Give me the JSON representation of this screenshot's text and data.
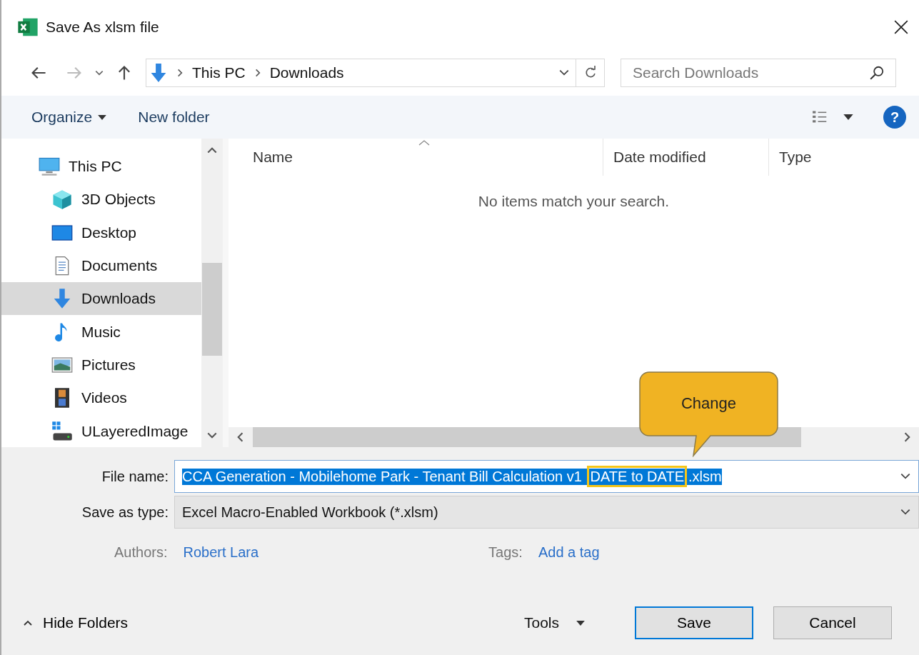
{
  "window": {
    "title": "Save As xlsm file"
  },
  "address": {
    "crumbs": [
      "This PC",
      "Downloads"
    ]
  },
  "search": {
    "placeholder": "Search Downloads"
  },
  "toolbar": {
    "organize": "Organize",
    "new_folder": "New folder",
    "help": "?"
  },
  "sidebar": {
    "items": [
      {
        "label": "This PC",
        "kind": "pc",
        "selected": false,
        "children": [
          {
            "label": "3D Objects",
            "kind": "cube",
            "selected": false
          },
          {
            "label": "Desktop",
            "kind": "desktop",
            "selected": false
          },
          {
            "label": "Documents",
            "kind": "document",
            "selected": false
          },
          {
            "label": "Downloads",
            "kind": "download",
            "selected": true
          },
          {
            "label": "Music",
            "kind": "music",
            "selected": false
          },
          {
            "label": "Pictures",
            "kind": "pictures",
            "selected": false
          },
          {
            "label": "Videos",
            "kind": "videos",
            "selected": false
          },
          {
            "label": "ULayeredImage",
            "kind": "drive",
            "selected": false
          }
        ]
      }
    ]
  },
  "table": {
    "columns": [
      {
        "label": "Name",
        "sorted": true
      },
      {
        "label": "Date modified",
        "sorted": false
      },
      {
        "label": "Type",
        "sorted": false
      }
    ],
    "empty_message": "No items match your search."
  },
  "callout": {
    "text": "Change"
  },
  "file_name": {
    "label": "File name:",
    "selected": true,
    "value_parts": [
      {
        "text": "CCA Generation - Mobilehome Park - Tenant Bill Calculation v1 ",
        "boxed": false
      },
      {
        "text": "DATE to DATE",
        "boxed": true
      },
      {
        "text": ".xlsm",
        "boxed": false
      }
    ]
  },
  "save_as_type": {
    "label": "Save as type:",
    "value": "Excel Macro-Enabled Workbook (*.xlsm)"
  },
  "authors": {
    "label": "Authors:",
    "value": "Robert Lara"
  },
  "tags": {
    "label": "Tags:",
    "value": "Add a tag"
  },
  "hide_folders": "Hide Folders",
  "tools": "Tools",
  "buttons": [
    {
      "label": "Save",
      "default": true
    },
    {
      "label": "Cancel",
      "default": false
    }
  ]
}
